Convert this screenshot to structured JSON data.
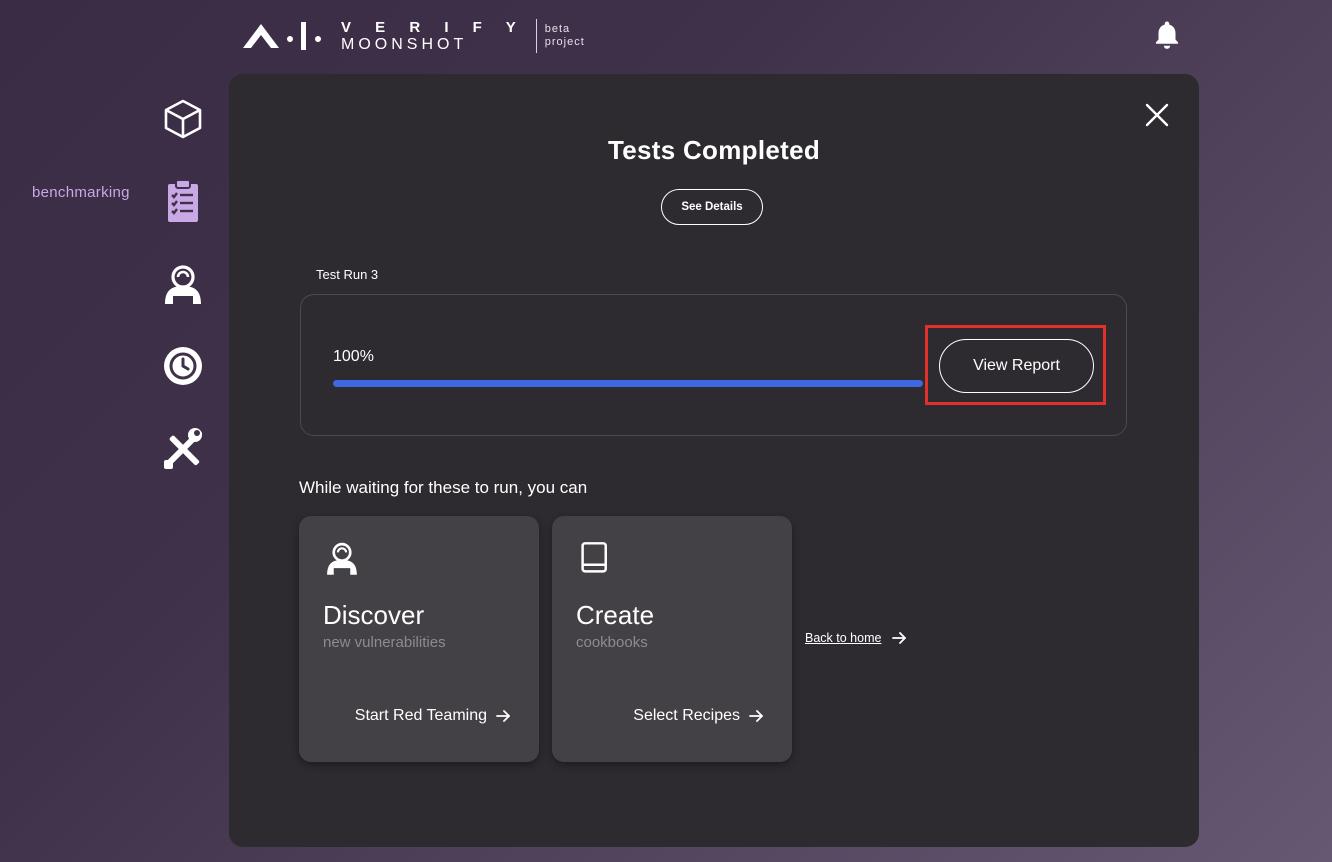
{
  "header": {
    "logo_verify": "V E R I F Y",
    "logo_moonshot": "MOONSHOT",
    "logo_beta_1": "beta",
    "logo_beta_2": "project",
    "notification_icon": "bell-icon"
  },
  "sidebar": {
    "items": [
      {
        "icon": "cube-icon",
        "label": ""
      },
      {
        "icon": "clipboard-checklist-icon",
        "label": "benchmarking",
        "active": true
      },
      {
        "icon": "red-teaming-icon",
        "label": ""
      },
      {
        "icon": "history-clock-icon",
        "label": ""
      },
      {
        "icon": "tools-icon",
        "label": ""
      }
    ],
    "active_color": "#c9a8e6"
  },
  "modal": {
    "title": "Tests Completed",
    "see_details": "See Details",
    "run_label": "Test Run 3",
    "progress_text": "100%",
    "progress_fraction": 1.0,
    "view_report": "View Report",
    "waiting_text": "While waiting for these to run, you can",
    "cards": [
      {
        "icon": "red-teaming-icon",
        "title": "Discover",
        "subtitle": "new vulnerabilities",
        "action": "Start Red Teaming"
      },
      {
        "icon": "book-icon",
        "title": "Create",
        "subtitle": "cookbooks",
        "action": "Select Recipes"
      }
    ],
    "back_home": "Back to home",
    "accent_color": "#3f68e0",
    "highlight_color": "#e2302a"
  }
}
